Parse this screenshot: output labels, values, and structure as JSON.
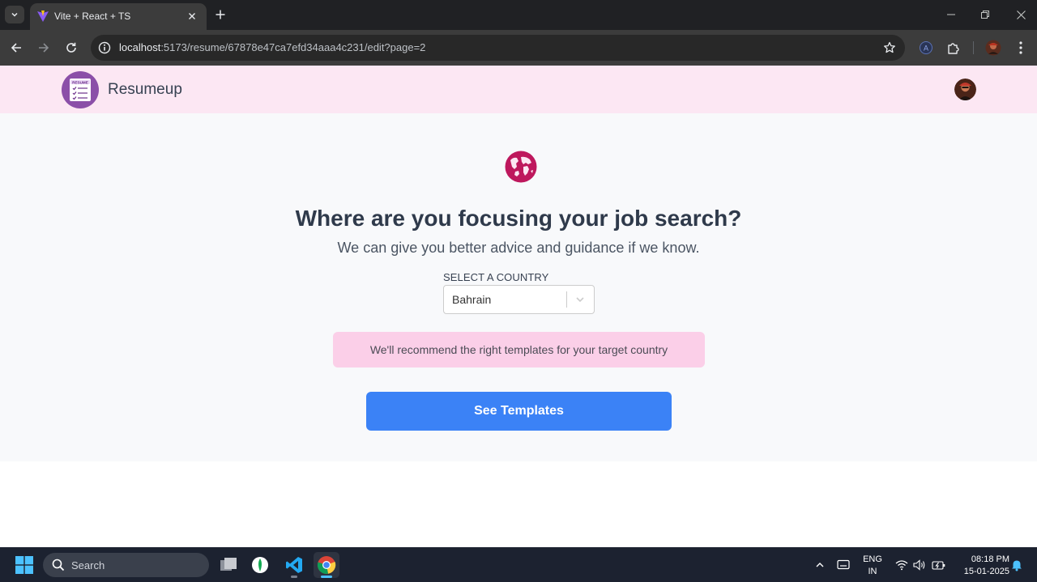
{
  "browser": {
    "tab_title": "Vite + React + TS",
    "url_host": "localhost",
    "url_path": ":5173/resume/67878e47ca7efd34aaa4c231/edit?page=2"
  },
  "header": {
    "brand": "Resumeup",
    "logo_text": "RESUME"
  },
  "main": {
    "heading": "Where are you focusing your job search?",
    "subheading": "We can give you better advice and guidance if we know.",
    "country_label": "SELECT A COUNTRY",
    "country_value": "Bahrain",
    "info_text": "We'll recommend the right templates for your target country",
    "cta_label": "See Templates"
  },
  "taskbar": {
    "search_placeholder": "Search",
    "lang_line1": "ENG",
    "lang_line2": "IN",
    "time": "08:18 PM",
    "date": "15-01-2025"
  },
  "colors": {
    "header_bg": "#fce7f3",
    "accent_pink": "#be185d",
    "banner_bg": "#fbcfe8",
    "cta_bg": "#3b82f6",
    "brand_purple": "#8b4fa8"
  }
}
